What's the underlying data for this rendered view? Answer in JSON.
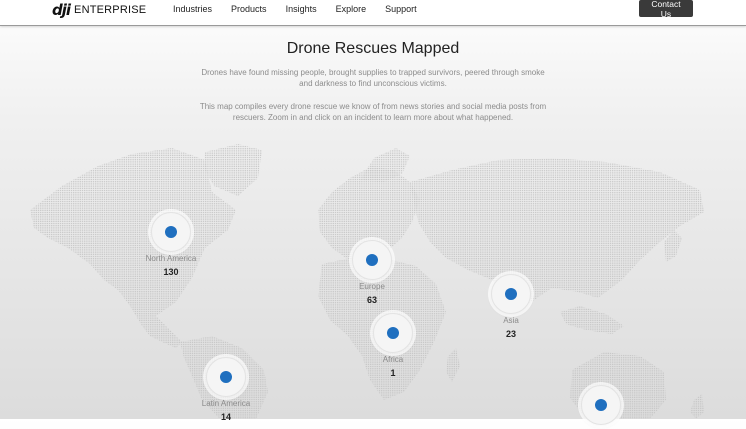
{
  "header": {
    "logo_mark": "dji",
    "logo_text": "ENTERPRISE",
    "nav": [
      "Industries",
      "Products",
      "Insights",
      "Explore",
      "Support"
    ],
    "contact_label": "Contact Us"
  },
  "main": {
    "title": "Drone Rescues Mapped",
    "intro_1": "Drones have found missing people, brought supplies to trapped survivors, peered through smoke and darkness to find unconscious victims.",
    "intro_2": "This map compiles every drone rescue we know of from news stories and social media posts from rescuers. Zoom in and click on an incident to learn more about what happened."
  },
  "map": {
    "marker_color": "#1f6fbf",
    "regions": [
      {
        "label": "North America",
        "count": "130"
      },
      {
        "label": "Europe",
        "count": "63"
      },
      {
        "label": "Asia",
        "count": "23"
      },
      {
        "label": "Africa",
        "count": "1"
      },
      {
        "label": "Latin America",
        "count": "14"
      },
      {
        "label": "",
        "count": ""
      }
    ]
  }
}
